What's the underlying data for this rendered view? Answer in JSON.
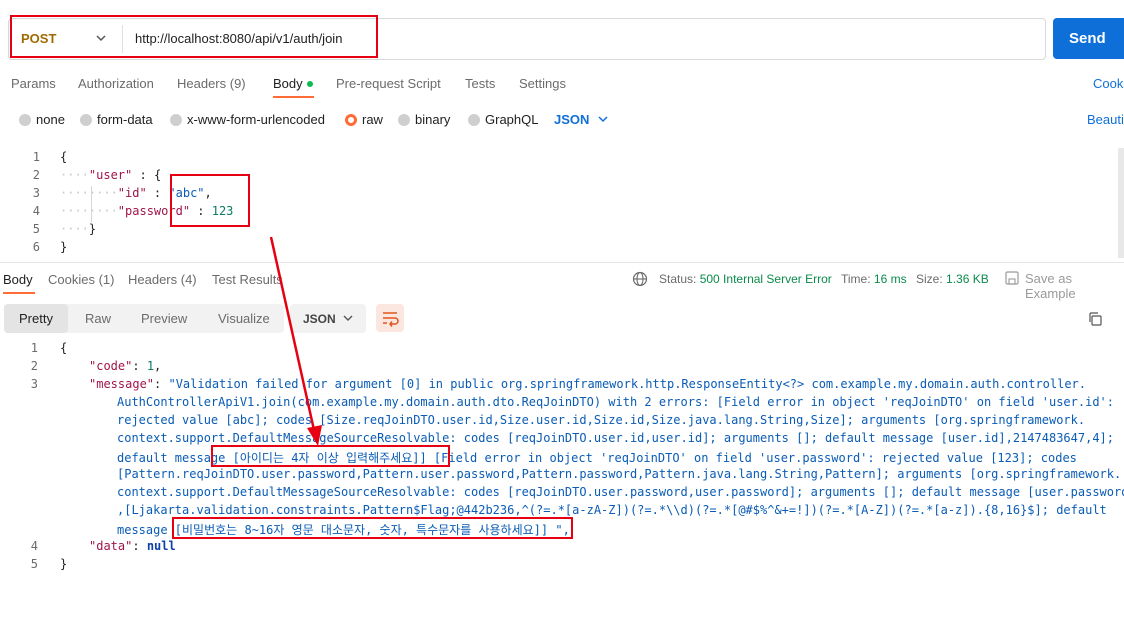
{
  "request": {
    "method": "POST",
    "url": "http://localhost:8080/api/v1/auth/join",
    "send_label": "Send"
  },
  "request_tabs": {
    "params": "Params",
    "authorization": "Authorization",
    "headers": "Headers (9)",
    "body": "Body",
    "pre_request": "Pre-request Script",
    "tests": "Tests",
    "settings": "Settings",
    "cookies": "Cook"
  },
  "body_types": {
    "none": "none",
    "form_data": "form-data",
    "urlencoded": "x-www-form-urlencoded",
    "raw": "raw",
    "binary": "binary",
    "graphql": "GraphQL",
    "format": "JSON",
    "beautify": "Beauti"
  },
  "request_body": {
    "line_numbers": [
      "1",
      "2",
      "3",
      "4",
      "5",
      "6"
    ],
    "open_brace": "{",
    "user_key": "\"user\"",
    "colon_open": " : {",
    "id_key": "\"id\"",
    "id_sep": " : ",
    "id_value": "\"abc\"",
    "comma": ",",
    "password_key": "\"password\"",
    "password_sep": " : ",
    "password_value": "123",
    "inner_close": "}",
    "close_brace": "}"
  },
  "response_tabs": {
    "body": "Body",
    "cookies": "Cookies (1)",
    "headers": "Headers (4)",
    "test_results": "Test Results"
  },
  "response_meta": {
    "status_label": "Status:",
    "status_value": "500 Internal Server Error",
    "time_label": "Time:",
    "time_value": "16 ms",
    "size_label": "Size:",
    "size_value": "1.36 KB",
    "save_example": "Save as Example"
  },
  "response_views": {
    "pretty": "Pretty",
    "raw": "Raw",
    "preview": "Preview",
    "visualize": "Visualize",
    "format": "JSON"
  },
  "response_body": {
    "line_numbers": [
      "1",
      "2",
      "3",
      "4",
      "5"
    ],
    "open_brace": "{",
    "code_key": "\"code\"",
    "code_value": "1",
    "message_key": "\"message\"",
    "message_lines": [
      "\"Validation failed for argument [0] in public org.springframework.http.ResponseEntity<?> com.example.my.domain.auth.controller.",
      "AuthControllerApiV1.join(com.example.my.domain.auth.dto.ReqJoinDTO) with 2 errors: [Field error in object 'reqJoinDTO' on field 'user.id':",
      "rejected value [abc]; codes [Size.reqJoinDTO.user.id,Size.user.id,Size.id,Size.java.lang.String,Size]; arguments [org.springframework.",
      "context.support.DefaultMessageSourceResolvable: codes [reqJoinDTO.user.id,user.id]; arguments []; default message [user.id],2147483647,4];",
      "default message [아이디는 4자 이상 입력해주세요]] [Field error in object 'reqJoinDTO' on field 'user.password': rejected value [123]; codes",
      "[Pattern.reqJoinDTO.user.password,Pattern.user.password,Pattern.password,Pattern.java.lang.String,Pattern]; arguments [org.springframework.",
      "context.support.DefaultMessageSourceResolvable: codes [reqJoinDTO.user.password,user.password]; arguments []; default message [user.password]",
      ",[Ljakarta.validation.constraints.Pattern$Flag;@442b236,^(?=.*[a-zA-Z])(?=.*\\\\d)(?=.*[@#$%^&+=!])(?=.*[A-Z])(?=.*[a-z]).{8,16}$]; default",
      "message [비밀번호는 8~16자 영문 대소문자, 숫자, 특수문자를 사용하세요]] \","
    ],
    "data_key": "\"data\"",
    "data_value": "null",
    "close_brace": "}"
  },
  "colors": {
    "accent": "#ff6c37",
    "send_button": "#0f6fd8",
    "annotation": "#e60012",
    "status_value": "#0b8a4a"
  },
  "icons": [
    "chevron-down-icon",
    "globe-icon",
    "save-icon",
    "wrap-lines-icon",
    "copy-icon"
  ]
}
